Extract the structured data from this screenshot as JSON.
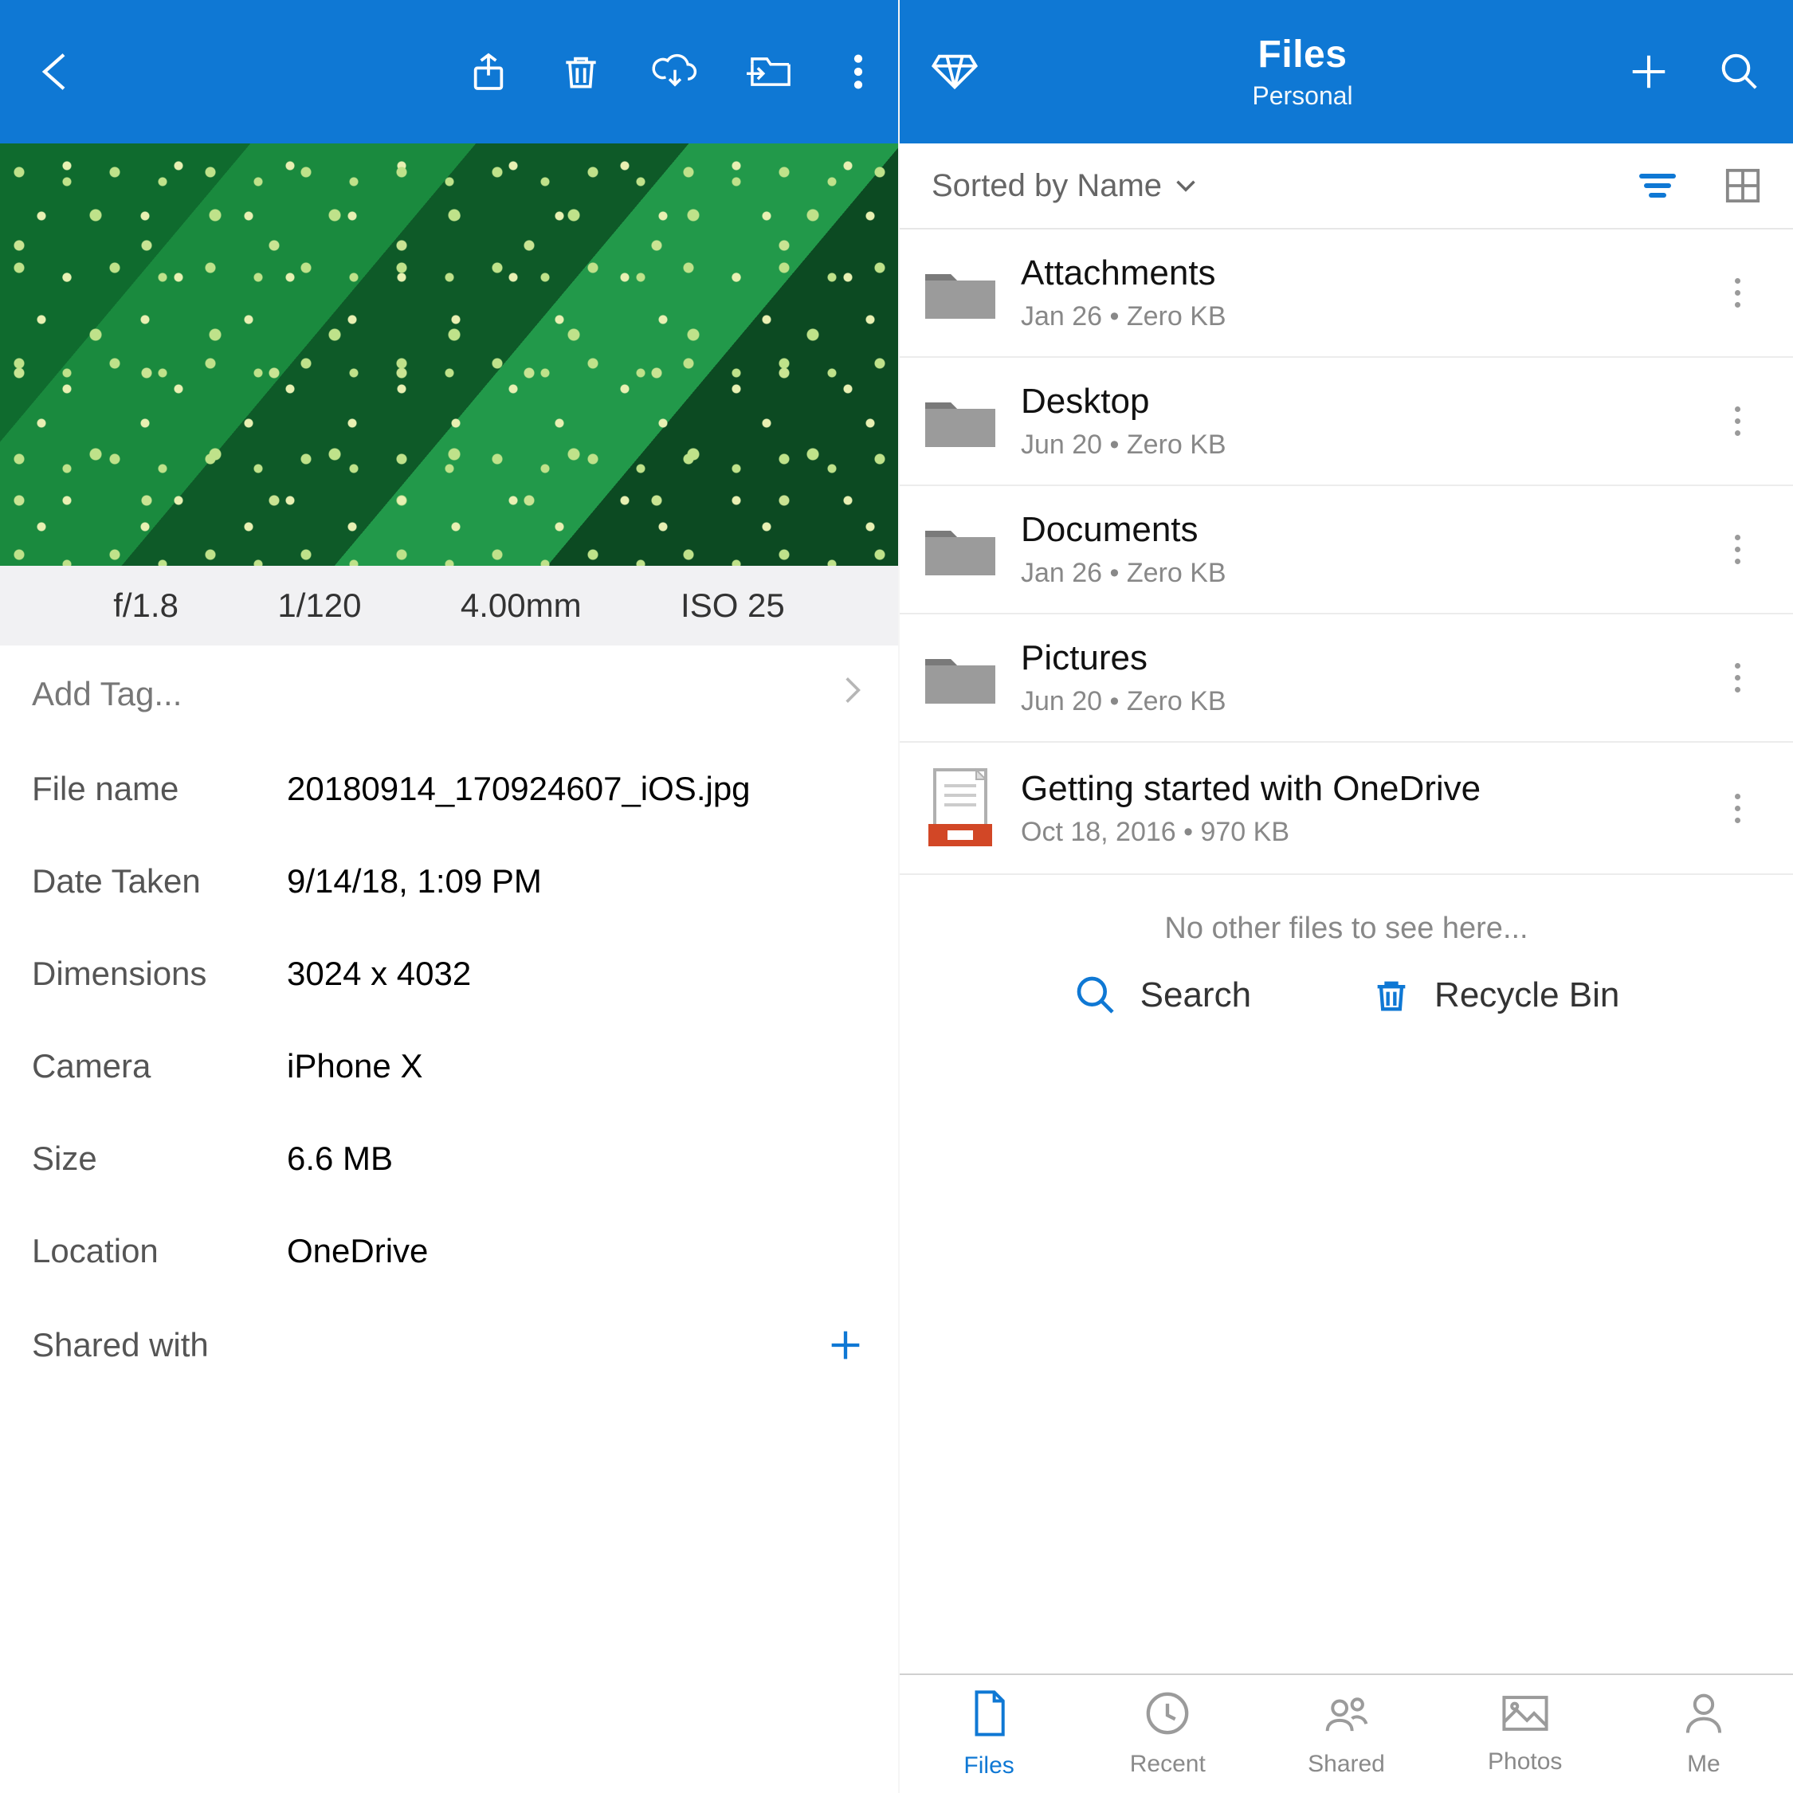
{
  "left": {
    "exif": {
      "aperture": "f/1.8",
      "shutter": "1/120",
      "focal": "4.00mm",
      "iso": "ISO 25"
    },
    "add_tag_label": "Add Tag...",
    "details": {
      "file_name_label": "File name",
      "file_name": "20180914_170924607_iOS.jpg",
      "date_label": "Date Taken",
      "date": "9/14/18, 1:09 PM",
      "dims_label": "Dimensions",
      "dims": "3024 x 4032",
      "camera_label": "Camera",
      "camera": "iPhone X",
      "size_label": "Size",
      "size": "6.6 MB",
      "location_label": "Location",
      "location": "OneDrive"
    },
    "shared_label": "Shared with"
  },
  "right": {
    "header": {
      "title": "Files",
      "subtitle": "Personal"
    },
    "sort_label": "Sorted by Name",
    "items": [
      {
        "name": "Attachments",
        "meta": "Jan 26 • Zero KB",
        "type": "folder"
      },
      {
        "name": "Desktop",
        "meta": "Jun 20 • Zero KB",
        "type": "folder"
      },
      {
        "name": "Documents",
        "meta": "Jan 26 • Zero KB",
        "type": "folder"
      },
      {
        "name": "Pictures",
        "meta": "Jun 20 • Zero KB",
        "type": "folder"
      },
      {
        "name": "Getting started with OneDrive",
        "meta": "Oct 18, 2016 • 970 KB",
        "type": "ppt"
      }
    ],
    "empty_note": "No other files to see here...",
    "actions": {
      "search": "Search",
      "recycle": "Recycle Bin"
    },
    "tabs": [
      {
        "label": "Files",
        "name": "files",
        "active": true
      },
      {
        "label": "Recent",
        "name": "recent"
      },
      {
        "label": "Shared",
        "name": "shared"
      },
      {
        "label": "Photos",
        "name": "photos"
      },
      {
        "label": "Me",
        "name": "me"
      }
    ]
  }
}
